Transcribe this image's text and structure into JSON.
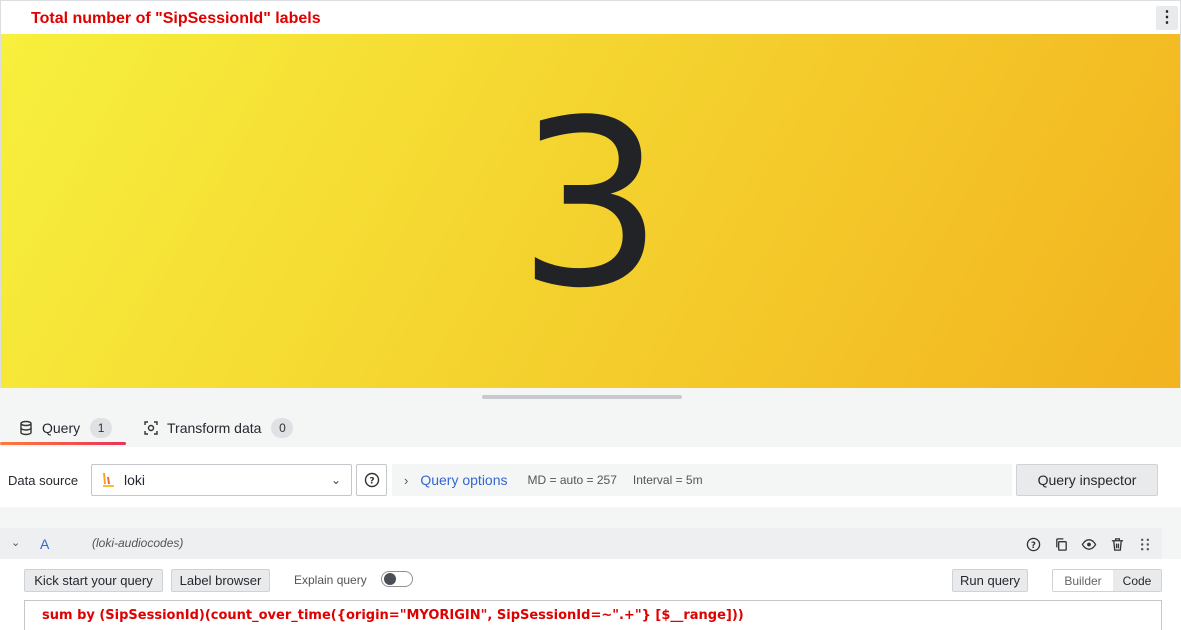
{
  "panel": {
    "title": "Total number of \"SipSessionId\" labels",
    "menu_icon": "vertical-dots-icon",
    "stat_value": "3",
    "gradient": [
      "#f7f03d",
      "#f2b31f"
    ]
  },
  "tabs": [
    {
      "label": "Query",
      "count": "1",
      "icon": "database-icon",
      "active": true
    },
    {
      "label": "Transform data",
      "count": "0",
      "icon": "transform-icon",
      "active": false
    }
  ],
  "datasource": {
    "label": "Data source",
    "selected": "loki",
    "query_options_label": "Query options",
    "md": "MD = auto = 257",
    "interval": "Interval = 5m",
    "inspector_label": "Query inspector"
  },
  "query_row": {
    "ref_id": "A",
    "datasource_name": "(loki-audiocodes)",
    "kick_start_label": "Kick start your query",
    "label_browser_label": "Label browser",
    "explain_label": "Explain query",
    "run_label": "Run query",
    "builder_label": "Builder",
    "code_label": "Code",
    "expression": "sum by (SipSessionId)(count_over_time({origin=\"MYORIGIN\", SipSessionId=~\".+\"} [$__range]))"
  },
  "colors": {
    "title_red": "#e00000",
    "link_blue": "#3467d1"
  }
}
